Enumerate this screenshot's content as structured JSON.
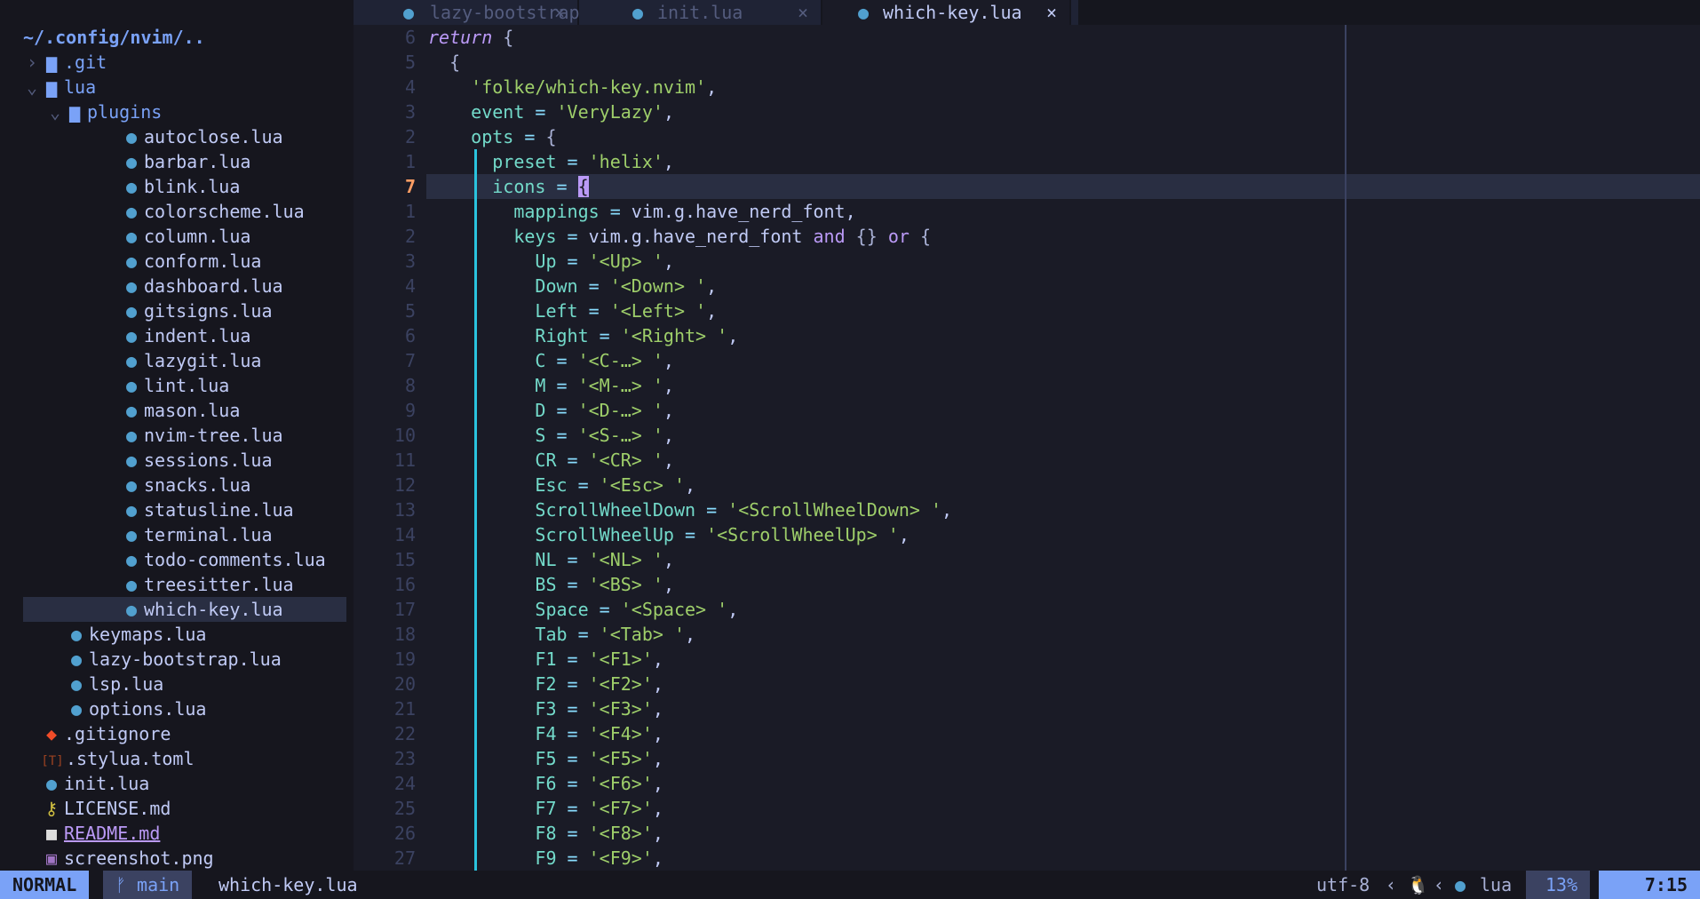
{
  "sidebar": {
    "root": "~/.config/nvim/..",
    "rows": [
      {
        "chev": "›",
        "icon": "▆",
        "iconName": "folder-icon",
        "name": ".git",
        "kind": "dir",
        "depth": 0
      },
      {
        "chev": "⌄",
        "icon": "▆",
        "iconName": "folder-open-icon",
        "name": "lua",
        "kind": "dir",
        "depth": 0
      },
      {
        "chev": "⌄",
        "icon": "▆",
        "iconName": "folder-open-icon",
        "name": "plugins",
        "kind": "dir",
        "depth": 1
      },
      {
        "icon": "●",
        "iconName": "lua-icon",
        "name": "autoclose.lua",
        "kind": "lua",
        "depth": 2
      },
      {
        "icon": "●",
        "iconName": "lua-icon",
        "name": "barbar.lua",
        "kind": "lua",
        "depth": 2
      },
      {
        "icon": "●",
        "iconName": "lua-icon",
        "name": "blink.lua",
        "kind": "lua",
        "depth": 2
      },
      {
        "icon": "●",
        "iconName": "lua-icon",
        "name": "colorscheme.lua",
        "kind": "lua",
        "depth": 2
      },
      {
        "icon": "●",
        "iconName": "lua-icon",
        "name": "column.lua",
        "kind": "lua",
        "depth": 2
      },
      {
        "icon": "●",
        "iconName": "lua-icon",
        "name": "conform.lua",
        "kind": "lua",
        "depth": 2
      },
      {
        "icon": "●",
        "iconName": "lua-icon",
        "name": "dashboard.lua",
        "kind": "lua",
        "depth": 2
      },
      {
        "icon": "●",
        "iconName": "lua-icon",
        "name": "gitsigns.lua",
        "kind": "lua",
        "depth": 2
      },
      {
        "icon": "●",
        "iconName": "lua-icon",
        "name": "indent.lua",
        "kind": "lua",
        "depth": 2
      },
      {
        "icon": "●",
        "iconName": "lua-icon",
        "name": "lazygit.lua",
        "kind": "lua",
        "depth": 2
      },
      {
        "icon": "●",
        "iconName": "lua-icon",
        "name": "lint.lua",
        "kind": "lua",
        "depth": 2
      },
      {
        "icon": "●",
        "iconName": "lua-icon",
        "name": "mason.lua",
        "kind": "lua",
        "depth": 2
      },
      {
        "icon": "●",
        "iconName": "lua-icon",
        "name": "nvim-tree.lua",
        "kind": "lua",
        "depth": 2
      },
      {
        "icon": "●",
        "iconName": "lua-icon",
        "name": "sessions.lua",
        "kind": "lua",
        "depth": 2
      },
      {
        "icon": "●",
        "iconName": "lua-icon",
        "name": "snacks.lua",
        "kind": "lua",
        "depth": 2
      },
      {
        "icon": "●",
        "iconName": "lua-icon",
        "name": "statusline.lua",
        "kind": "lua",
        "depth": 2
      },
      {
        "icon": "●",
        "iconName": "lua-icon",
        "name": "terminal.lua",
        "kind": "lua",
        "depth": 2
      },
      {
        "icon": "●",
        "iconName": "lua-icon",
        "name": "todo-comments.lua",
        "kind": "lua",
        "depth": 2
      },
      {
        "icon": "●",
        "iconName": "lua-icon",
        "name": "treesitter.lua",
        "kind": "lua",
        "depth": 2
      },
      {
        "icon": "●",
        "iconName": "lua-icon",
        "name": "which-key.lua",
        "kind": "lua",
        "depth": 2,
        "selected": true
      },
      {
        "icon": "●",
        "iconName": "lua-icon",
        "name": "keymaps.lua",
        "kind": "lua",
        "depth": 1
      },
      {
        "icon": "●",
        "iconName": "lua-icon",
        "name": "lazy-bootstrap.lua",
        "kind": "lua",
        "depth": 1
      },
      {
        "icon": "●",
        "iconName": "lua-icon",
        "name": "lsp.lua",
        "kind": "lua",
        "depth": 1
      },
      {
        "icon": "●",
        "iconName": "lua-icon",
        "name": "options.lua",
        "kind": "lua",
        "depth": 1
      },
      {
        "icon": "◆",
        "iconName": "git-icon",
        "name": ".gitignore",
        "kind": "git",
        "depth": 0
      },
      {
        "icon": "[T]",
        "iconName": "toml-icon",
        "name": ".stylua.toml",
        "kind": "toml",
        "depth": 0
      },
      {
        "icon": "●",
        "iconName": "lua-icon",
        "name": "init.lua",
        "kind": "lua",
        "depth": 0
      },
      {
        "icon": "⚷",
        "iconName": "license-icon",
        "name": "LICENSE.md",
        "kind": "lic",
        "depth": 0
      },
      {
        "icon": "■",
        "iconName": "markdown-icon",
        "name": "README.md",
        "kind": "md",
        "depth": 0
      },
      {
        "icon": "▣",
        "iconName": "image-icon",
        "name": "screenshot.png",
        "kind": "png",
        "depth": 0
      }
    ]
  },
  "tabs": [
    {
      "label": "lazy-bootstrap.lua",
      "icon": "●",
      "close": "×",
      "active": false
    },
    {
      "label": "init.lua",
      "icon": "●",
      "close": "×",
      "active": false
    },
    {
      "label": "which-key.lua",
      "icon": "●",
      "close": "×",
      "active": true
    }
  ],
  "editor": {
    "lines": [
      {
        "n": "6",
        "t": [
          [
            "kw",
            "return"
          ],
          [
            "id",
            " "
          ],
          [
            "br",
            "{"
          ]
        ]
      },
      {
        "n": "5",
        "t": [
          [
            "id",
            "  "
          ],
          [
            "br",
            "{"
          ]
        ]
      },
      {
        "n": "4",
        "t": [
          [
            "id",
            "    "
          ],
          [
            "str",
            "'folke/which-key.nvim'"
          ],
          [
            "id",
            ","
          ]
        ]
      },
      {
        "n": "3",
        "t": [
          [
            "id",
            "    "
          ],
          [
            "key",
            "event"
          ],
          [
            "op",
            " = "
          ],
          [
            "str",
            "'VeryLazy'"
          ],
          [
            "id",
            ","
          ]
        ]
      },
      {
        "n": "2",
        "t": [
          [
            "id",
            "    "
          ],
          [
            "key",
            "opts"
          ],
          [
            "op",
            " = "
          ],
          [
            "br",
            "{"
          ]
        ]
      },
      {
        "n": "1",
        "t": [
          [
            "id",
            "      "
          ],
          [
            "key",
            "preset"
          ],
          [
            "op",
            " = "
          ],
          [
            "str",
            "'helix'"
          ],
          [
            "id",
            ","
          ]
        ]
      },
      {
        "n": "7",
        "cur": true,
        "t": [
          [
            "id",
            "      "
          ],
          [
            "key",
            "icons"
          ],
          [
            "op",
            " = "
          ],
          [
            "cur",
            "{"
          ]
        ]
      },
      {
        "n": "1",
        "t": [
          [
            "id",
            "        "
          ],
          [
            "key",
            "mappings"
          ],
          [
            "op",
            " = "
          ],
          [
            "id",
            "vim.g.have_nerd_font,"
          ]
        ]
      },
      {
        "n": "2",
        "t": [
          [
            "id",
            "        "
          ],
          [
            "key",
            "keys"
          ],
          [
            "op",
            " = "
          ],
          [
            "id",
            "vim.g.have_nerd_font "
          ],
          [
            "kw2",
            "and"
          ],
          [
            "id",
            " "
          ],
          [
            "br",
            "{}"
          ],
          [
            "id",
            " "
          ],
          [
            "kw2",
            "or"
          ],
          [
            "id",
            " "
          ],
          [
            "br",
            "{"
          ]
        ]
      },
      {
        "n": "3",
        "t": [
          [
            "id",
            "          "
          ],
          [
            "key",
            "Up"
          ],
          [
            "op",
            " = "
          ],
          [
            "str",
            "'<Up> '"
          ],
          [
            "id",
            ","
          ]
        ]
      },
      {
        "n": "4",
        "t": [
          [
            "id",
            "          "
          ],
          [
            "key",
            "Down"
          ],
          [
            "op",
            " = "
          ],
          [
            "str",
            "'<Down> '"
          ],
          [
            "id",
            ","
          ]
        ]
      },
      {
        "n": "5",
        "t": [
          [
            "id",
            "          "
          ],
          [
            "key",
            "Left"
          ],
          [
            "op",
            " = "
          ],
          [
            "str",
            "'<Left> '"
          ],
          [
            "id",
            ","
          ]
        ]
      },
      {
        "n": "6",
        "t": [
          [
            "id",
            "          "
          ],
          [
            "key",
            "Right"
          ],
          [
            "op",
            " = "
          ],
          [
            "str",
            "'<Right> '"
          ],
          [
            "id",
            ","
          ]
        ]
      },
      {
        "n": "7",
        "t": [
          [
            "id",
            "          "
          ],
          [
            "key",
            "C"
          ],
          [
            "op",
            " = "
          ],
          [
            "str",
            "'<C-…> '"
          ],
          [
            "id",
            ","
          ]
        ]
      },
      {
        "n": "8",
        "t": [
          [
            "id",
            "          "
          ],
          [
            "key",
            "M"
          ],
          [
            "op",
            " = "
          ],
          [
            "str",
            "'<M-…> '"
          ],
          [
            "id",
            ","
          ]
        ]
      },
      {
        "n": "9",
        "t": [
          [
            "id",
            "          "
          ],
          [
            "key",
            "D"
          ],
          [
            "op",
            " = "
          ],
          [
            "str",
            "'<D-…> '"
          ],
          [
            "id",
            ","
          ]
        ]
      },
      {
        "n": "10",
        "t": [
          [
            "id",
            "          "
          ],
          [
            "key",
            "S"
          ],
          [
            "op",
            " = "
          ],
          [
            "str",
            "'<S-…> '"
          ],
          [
            "id",
            ","
          ]
        ]
      },
      {
        "n": "11",
        "t": [
          [
            "id",
            "          "
          ],
          [
            "key",
            "CR"
          ],
          [
            "op",
            " = "
          ],
          [
            "str",
            "'<CR> '"
          ],
          [
            "id",
            ","
          ]
        ]
      },
      {
        "n": "12",
        "t": [
          [
            "id",
            "          "
          ],
          [
            "key",
            "Esc"
          ],
          [
            "op",
            " = "
          ],
          [
            "str",
            "'<Esc> '"
          ],
          [
            "id",
            ","
          ]
        ]
      },
      {
        "n": "13",
        "t": [
          [
            "id",
            "          "
          ],
          [
            "key",
            "ScrollWheelDown"
          ],
          [
            "op",
            " = "
          ],
          [
            "str",
            "'<ScrollWheelDown> '"
          ],
          [
            "id",
            ","
          ]
        ]
      },
      {
        "n": "14",
        "t": [
          [
            "id",
            "          "
          ],
          [
            "key",
            "ScrollWheelUp"
          ],
          [
            "op",
            " = "
          ],
          [
            "str",
            "'<ScrollWheelUp> '"
          ],
          [
            "id",
            ","
          ]
        ]
      },
      {
        "n": "15",
        "t": [
          [
            "id",
            "          "
          ],
          [
            "key",
            "NL"
          ],
          [
            "op",
            " = "
          ],
          [
            "str",
            "'<NL> '"
          ],
          [
            "id",
            ","
          ]
        ]
      },
      {
        "n": "16",
        "t": [
          [
            "id",
            "          "
          ],
          [
            "key",
            "BS"
          ],
          [
            "op",
            " = "
          ],
          [
            "str",
            "'<BS> '"
          ],
          [
            "id",
            ","
          ]
        ]
      },
      {
        "n": "17",
        "t": [
          [
            "id",
            "          "
          ],
          [
            "key",
            "Space"
          ],
          [
            "op",
            " = "
          ],
          [
            "str",
            "'<Space> '"
          ],
          [
            "id",
            ","
          ]
        ]
      },
      {
        "n": "18",
        "t": [
          [
            "id",
            "          "
          ],
          [
            "key",
            "Tab"
          ],
          [
            "op",
            " = "
          ],
          [
            "str",
            "'<Tab> '"
          ],
          [
            "id",
            ","
          ]
        ]
      },
      {
        "n": "19",
        "t": [
          [
            "id",
            "          "
          ],
          [
            "key",
            "F1"
          ],
          [
            "op",
            " = "
          ],
          [
            "str",
            "'<F1>'"
          ],
          [
            "id",
            ","
          ]
        ]
      },
      {
        "n": "20",
        "t": [
          [
            "id",
            "          "
          ],
          [
            "key",
            "F2"
          ],
          [
            "op",
            " = "
          ],
          [
            "str",
            "'<F2>'"
          ],
          [
            "id",
            ","
          ]
        ]
      },
      {
        "n": "21",
        "t": [
          [
            "id",
            "          "
          ],
          [
            "key",
            "F3"
          ],
          [
            "op",
            " = "
          ],
          [
            "str",
            "'<F3>'"
          ],
          [
            "id",
            ","
          ]
        ]
      },
      {
        "n": "22",
        "t": [
          [
            "id",
            "          "
          ],
          [
            "key",
            "F4"
          ],
          [
            "op",
            " = "
          ],
          [
            "str",
            "'<F4>'"
          ],
          [
            "id",
            ","
          ]
        ]
      },
      {
        "n": "23",
        "t": [
          [
            "id",
            "          "
          ],
          [
            "key",
            "F5"
          ],
          [
            "op",
            " = "
          ],
          [
            "str",
            "'<F5>'"
          ],
          [
            "id",
            ","
          ]
        ]
      },
      {
        "n": "24",
        "t": [
          [
            "id",
            "          "
          ],
          [
            "key",
            "F6"
          ],
          [
            "op",
            " = "
          ],
          [
            "str",
            "'<F6>'"
          ],
          [
            "id",
            ","
          ]
        ]
      },
      {
        "n": "25",
        "t": [
          [
            "id",
            "          "
          ],
          [
            "key",
            "F7"
          ],
          [
            "op",
            " = "
          ],
          [
            "str",
            "'<F7>'"
          ],
          [
            "id",
            ","
          ]
        ]
      },
      {
        "n": "26",
        "t": [
          [
            "id",
            "          "
          ],
          [
            "key",
            "F8"
          ],
          [
            "op",
            " = "
          ],
          [
            "str",
            "'<F8>'"
          ],
          [
            "id",
            ","
          ]
        ]
      },
      {
        "n": "27",
        "t": [
          [
            "id",
            "          "
          ],
          [
            "key",
            "F9"
          ],
          [
            "op",
            " = "
          ],
          [
            "str",
            "'<F9>'"
          ],
          [
            "id",
            ","
          ]
        ]
      }
    ]
  },
  "statusline": {
    "mode": "NORMAL",
    "branch_icon": "ᚠ",
    "branch": "main",
    "filename": "which-key.lua",
    "encoding": "utf-8",
    "sep": "‹",
    "os_icon": "🐧",
    "filetype_icon": "●",
    "filetype": "lua",
    "percent": "13%",
    "position": "7:15"
  },
  "colors": {
    "background": "#1a1b26",
    "sidebar": "#16161e",
    "accent": "#7aa2f7",
    "cursorline": "#292e42"
  }
}
